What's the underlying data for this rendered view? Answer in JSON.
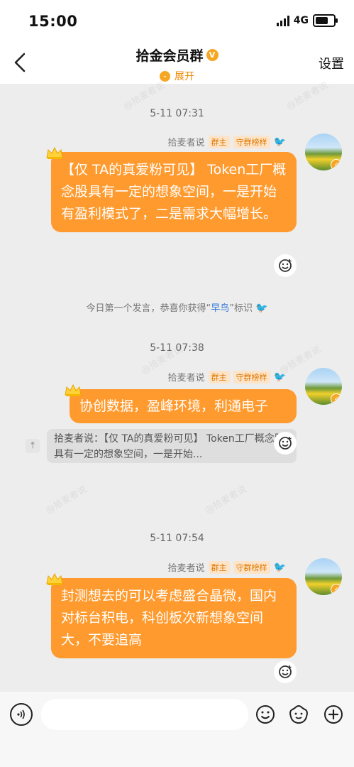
{
  "status": {
    "time": "15:00",
    "network": "4G"
  },
  "header": {
    "title": "拾金会员群",
    "badge": "V",
    "expand_label": "展开",
    "settings_label": "设置"
  },
  "messages": [
    {
      "timestamp": "5-11 07:31",
      "sender": "拾麦者说",
      "tags": [
        "群主",
        "守群榜样"
      ],
      "text": "【仅 TA的真爱粉可见】 Token工厂概念股具有一定的想象空间，一是开始有盈利模式了，二是需求大幅增长。",
      "system_note": {
        "prefix": "今日第一个发言，恭喜你获得“",
        "highlight": "早鸟",
        "suffix": "”标识"
      }
    },
    {
      "timestamp": "5-11 07:38",
      "sender": "拾麦者说",
      "tags": [
        "群主",
        "守群榜样"
      ],
      "text": "协创数据，盈峰环境，利通电子",
      "quote": "拾麦者说：【仅 TA的真爱粉可见】 Token工厂概念股具有一定的想象空间，一是开始..."
    },
    {
      "timestamp": "5-11 07:54",
      "sender": "拾麦者说",
      "tags": [
        "群主",
        "守群榜样"
      ],
      "text": "封测想去的可以考虑盛合晶微，国内对标台积电，科创板次新想象空间大，不要追高"
    }
  ],
  "watermark": "@拾麦者说",
  "input": {
    "placeholder": ""
  },
  "colors": {
    "bubble": "#ff9a2e",
    "accent": "#f08a00",
    "chat_bg": "#ededed"
  }
}
